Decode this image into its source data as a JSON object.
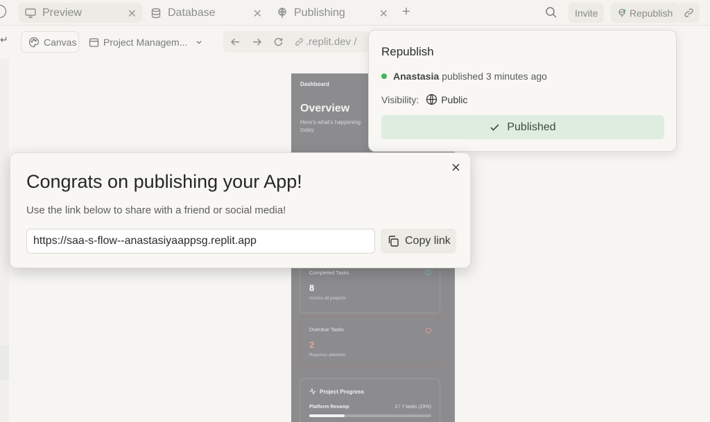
{
  "tabs": [
    {
      "label": "Preview",
      "icon": "monitor-icon",
      "active": true
    },
    {
      "label": "Database",
      "icon": "database-icon",
      "active": false
    },
    {
      "label": "Publishing",
      "icon": "publishing-icon",
      "active": false
    }
  ],
  "top_actions": {
    "invite_label": "Invite",
    "republish_label": "Republish"
  },
  "toolbar": {
    "canvas_label": "Canvas",
    "project_label": "Project Managem...",
    "url_text": ".replit.dev /"
  },
  "preview": {
    "breadcrumb": "Dashboard",
    "heading": "Overview",
    "subtitle": "Here's what's happening today.",
    "cards": [
      {
        "title": "Completed Tasks",
        "value": "8",
        "sub": "Across all projects"
      },
      {
        "title": "Overdue Tasks",
        "value": "2",
        "sub": "Requires attention"
      }
    ],
    "progress": {
      "title": "Project Progress",
      "item": "Platform Revamp",
      "value_text": "2 / 7 tasks (29%)",
      "fraction": 0.29
    }
  },
  "republish_panel": {
    "title": "Republish",
    "publisher": "Anastasia",
    "status_text": "published 3 minutes ago",
    "visibility_label": "Visibility:",
    "visibility_value": "Public",
    "button_label": "Published",
    "status_color": "#44b35e"
  },
  "congrats_dialog": {
    "title": "Congrats on publishing your App!",
    "subtitle": "Use the link below to share with a friend or social media!",
    "link": "https://saa-s-flow--anastasiyaappsg.replit.app",
    "copy_label": "Copy link"
  }
}
